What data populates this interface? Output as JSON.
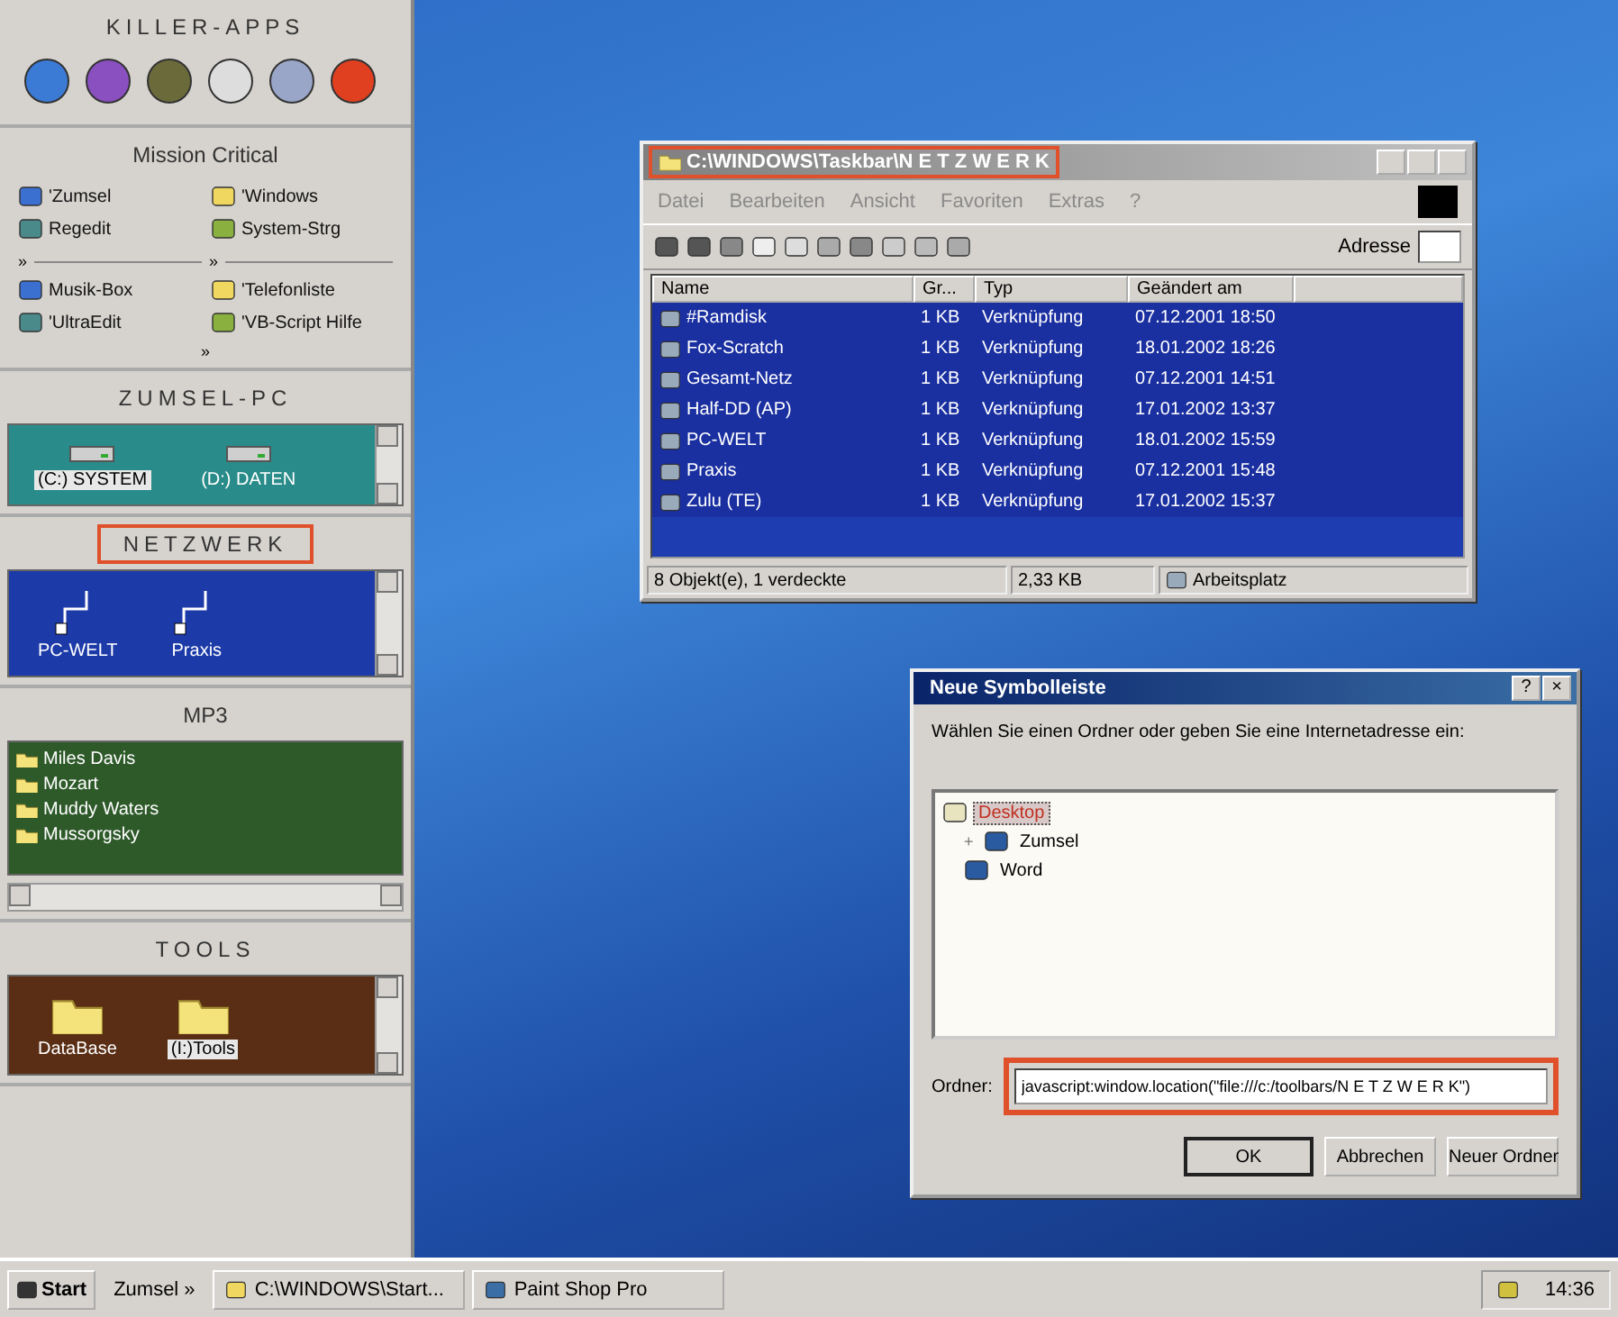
{
  "sidebar": {
    "sections": [
      {
        "kind": "apps",
        "title": "KILLER-APPS",
        "highlighted": false
      },
      {
        "kind": "launcher",
        "title": "Mission Critical",
        "highlighted": false,
        "groups": [
          {
            "items": [
              {
                "label": "'Zumsel"
              },
              {
                "label": "'Windows"
              },
              {
                "label": "Regedit"
              },
              {
                "label": "System-Strg"
              }
            ]
          },
          {
            "marker": "»",
            "items": [
              {
                "label": "Musik-Box"
              },
              {
                "label": "'Telefonliste"
              },
              {
                "label": "'UltraEdit"
              },
              {
                "label": "'VB-Script Hilfe"
              }
            ]
          }
        ],
        "more": "»"
      },
      {
        "kind": "drives",
        "title": "ZUMSEL-PC",
        "highlighted": false,
        "items": [
          {
            "label": "(C:) SYSTEM",
            "selected": true
          },
          {
            "label": "(D:) DATEN",
            "selected": false
          }
        ]
      },
      {
        "kind": "network",
        "title": "NETZWERK",
        "highlighted": true,
        "items": [
          {
            "label": "PC-WELT",
            "selected": false
          },
          {
            "label": "Praxis",
            "selected": false
          }
        ]
      },
      {
        "kind": "folders",
        "title": "MP3",
        "highlighted": false,
        "items": [
          {
            "label": "Miles Davis"
          },
          {
            "label": "Mozart"
          },
          {
            "label": "Muddy Waters"
          },
          {
            "label": "Mussorgsky"
          }
        ]
      },
      {
        "kind": "tools",
        "title": "TOOLS",
        "highlighted": false,
        "items": [
          {
            "label": "DataBase",
            "selected": false
          },
          {
            "label": "(I:)Tools",
            "selected": true
          }
        ]
      }
    ]
  },
  "explorer": {
    "title": "C:\\WINDOWS\\Taskbar\\N E T Z W E R K",
    "title_highlighted": true,
    "menu": [
      "Datei",
      "Bearbeiten",
      "Ansicht",
      "Favoriten",
      "Extras",
      "?"
    ],
    "address_label": "Adresse",
    "columns": [
      "Name",
      "Gr...",
      "Typ",
      "Geändert am"
    ],
    "rows": [
      {
        "name": "#Ramdisk",
        "size": "1 KB",
        "type": "Verknüpfung",
        "modified": "07.12.2001 18:50",
        "selected": true
      },
      {
        "name": "Fox-Scratch",
        "size": "1 KB",
        "type": "Verknüpfung",
        "modified": "18.01.2002 18:26",
        "selected": true
      },
      {
        "name": "Gesamt-Netz",
        "size": "1 KB",
        "type": "Verknüpfung",
        "modified": "07.12.2001 14:51",
        "selected": true
      },
      {
        "name": "Half-DD (AP)",
        "size": "1 KB",
        "type": "Verknüpfung",
        "modified": "17.01.2002 13:37",
        "selected": true
      },
      {
        "name": "PC-WELT",
        "size": "1 KB",
        "type": "Verknüpfung",
        "modified": "18.01.2002 15:59",
        "selected": true
      },
      {
        "name": "Praxis",
        "size": "1 KB",
        "type": "Verknüpfung",
        "modified": "07.12.2001 15:48",
        "selected": true
      },
      {
        "name": "Zulu (TE)",
        "size": "1 KB",
        "type": "Verknüpfung",
        "modified": "17.01.2002 15:37",
        "selected": true
      }
    ],
    "status": [
      "8 Objekt(e), 1 verdeckte",
      "2,33 KB",
      "Arbeitsplatz"
    ]
  },
  "dialog": {
    "title": "Neue Symbolleiste",
    "title_buttons": [
      "?",
      "×"
    ],
    "prompt": "Wählen Sie einen Ordner oder geben Sie eine Internetadresse ein:",
    "tree": [
      {
        "label": "Desktop",
        "selected": true,
        "children": [
          {
            "label": "Zumsel",
            "selected": false,
            "expandable": "+"
          },
          {
            "label": "Word",
            "selected": false
          }
        ]
      }
    ],
    "field_label": "Ordner:",
    "field_value": "javascript:window.location(\"file:///c:/toolbars/N E T Z W E R K\")",
    "field_highlighted": true,
    "buttons": [
      "OK",
      "Abbrechen",
      "Neuer Ordner"
    ]
  },
  "taskbar": {
    "start": "Start",
    "items": [
      {
        "label": "Zumsel »",
        "kind": "toolbar"
      },
      {
        "label": "C:\\WINDOWS\\Start...",
        "kind": "window"
      },
      {
        "label": "Paint Shop Pro",
        "kind": "window"
      }
    ],
    "clock": "14:36"
  }
}
